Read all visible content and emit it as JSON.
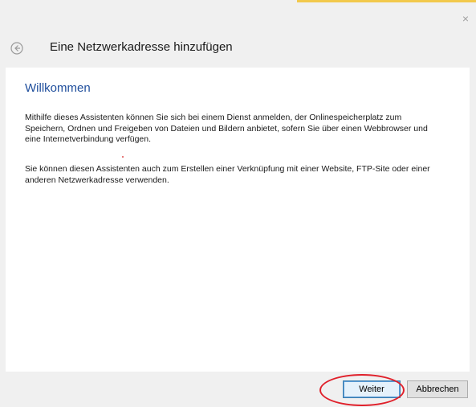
{
  "window": {
    "close_label": "×"
  },
  "header": {
    "back_icon": "back-arrow-icon",
    "title": "Eine Netzwerkadresse hinzufügen"
  },
  "main": {
    "heading": "Willkommen",
    "paragraph1": "Mithilfe dieses Assistenten können Sie sich bei einem Dienst anmelden, der Onlinespeicherplatz zum Speichern, Ordnen und Freigeben von Dateien und Bildern anbietet, sofern Sie über einen Webbrowser und eine Internetverbindung verfügen.",
    "paragraph2": "Sie können diesen Assistenten auch zum Erstellen einer Verknüpfung mit einer Website, FTP-Site oder einer anderen Netzwerkadresse verwenden."
  },
  "footer": {
    "next_label": "Weiter",
    "cancel_label": "Abbrechen"
  },
  "colors": {
    "heading": "#1f4e9c",
    "annotation": "#e0202a",
    "accent": "#f2c94c"
  }
}
